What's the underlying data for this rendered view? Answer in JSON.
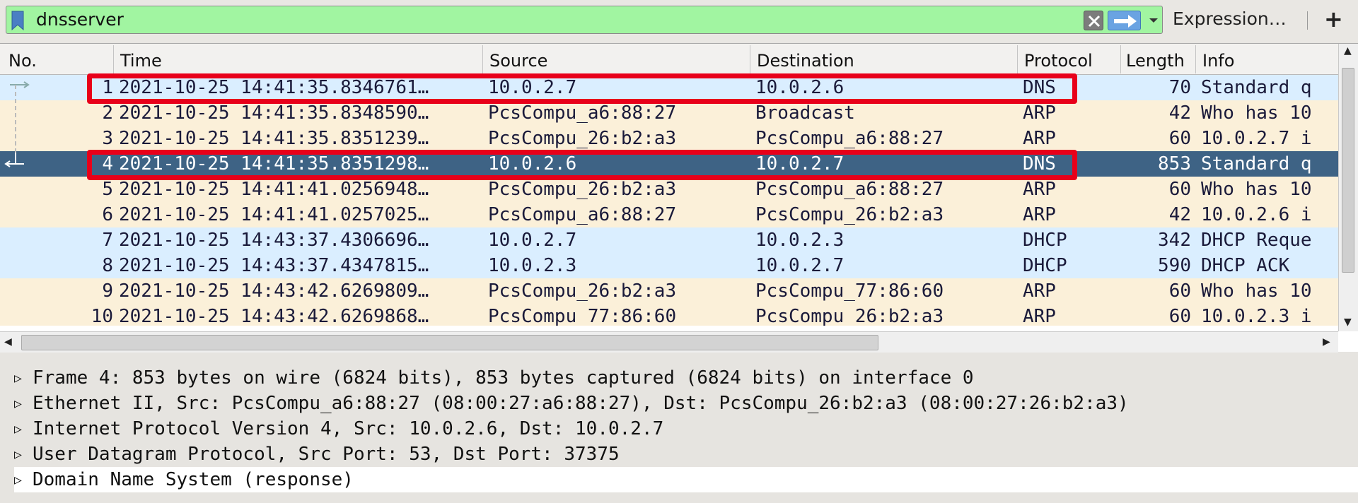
{
  "filter": {
    "value": "dnsserver",
    "expression_label": "Expression…",
    "add_label": "+"
  },
  "columns": {
    "no": "No.",
    "time": "Time",
    "source": "Source",
    "destination": "Destination",
    "protocol": "Protocol",
    "length": "Length",
    "info": "Info"
  },
  "packets": [
    {
      "no": "1",
      "time": "2021-10-25 14:41:35.8346761…",
      "source": "10.0.2.7",
      "destination": "10.0.2.6",
      "protocol": "DNS",
      "length": "70",
      "info": "Standard q"
    },
    {
      "no": "2",
      "time": "2021-10-25 14:41:35.8348590…",
      "source": "PcsCompu_a6:88:27",
      "destination": "Broadcast",
      "protocol": "ARP",
      "length": "42",
      "info": "Who has 10"
    },
    {
      "no": "3",
      "time": "2021-10-25 14:41:35.8351239…",
      "source": "PcsCompu_26:b2:a3",
      "destination": "PcsCompu_a6:88:27",
      "protocol": "ARP",
      "length": "60",
      "info": "10.0.2.7 i"
    },
    {
      "no": "4",
      "time": "2021-10-25 14:41:35.8351298…",
      "source": "10.0.2.6",
      "destination": "10.0.2.7",
      "protocol": "DNS",
      "length": "853",
      "info": "Standard q"
    },
    {
      "no": "5",
      "time": "2021-10-25 14:41:41.0256948…",
      "source": "PcsCompu_26:b2:a3",
      "destination": "PcsCompu_a6:88:27",
      "protocol": "ARP",
      "length": "60",
      "info": "Who has 10"
    },
    {
      "no": "6",
      "time": "2021-10-25 14:41:41.0257025…",
      "source": "PcsCompu_a6:88:27",
      "destination": "PcsCompu_26:b2:a3",
      "protocol": "ARP",
      "length": "42",
      "info": "10.0.2.6 i"
    },
    {
      "no": "7",
      "time": "2021-10-25 14:43:37.4306696…",
      "source": "10.0.2.7",
      "destination": "10.0.2.3",
      "protocol": "DHCP",
      "length": "342",
      "info": "DHCP Reque"
    },
    {
      "no": "8",
      "time": "2021-10-25 14:43:37.4347815…",
      "source": "10.0.2.3",
      "destination": "10.0.2.7",
      "protocol": "DHCP",
      "length": "590",
      "info": "DHCP ACK"
    },
    {
      "no": "9",
      "time": "2021-10-25 14:43:42.6269809…",
      "source": "PcsCompu_26:b2:a3",
      "destination": "PcsCompu_77:86:60",
      "protocol": "ARP",
      "length": "60",
      "info": "Who has 10"
    },
    {
      "no": "10",
      "time": "2021-10-25 14:43:42.6269868…",
      "source": "PcsCompu_77:86:60",
      "destination": "PcsCompu_26:b2:a3",
      "protocol": "ARP",
      "length": "60",
      "info": "10.0.2.3 i"
    }
  ],
  "selected_packet": "4",
  "highlighted_packets": [
    "1",
    "4"
  ],
  "details": [
    "Frame 4: 853 bytes on wire (6824 bits), 853 bytes captured (6824 bits) on interface 0",
    "Ethernet II, Src: PcsCompu_a6:88:27 (08:00:27:a6:88:27), Dst: PcsCompu_26:b2:a3 (08:00:27:26:b2:a3)",
    "Internet Protocol Version 4, Src: 10.0.2.6, Dst: 10.0.2.7",
    "User Datagram Protocol, Src Port: 53, Dst Port: 37375",
    "Domain Name System (response)"
  ],
  "colors": {
    "filter_valid": "#a1f5a1",
    "row_dns": "#daeeff",
    "row_arp": "#fbf0d9",
    "row_selected": "#3e6385",
    "highlight": "#e8001a"
  }
}
